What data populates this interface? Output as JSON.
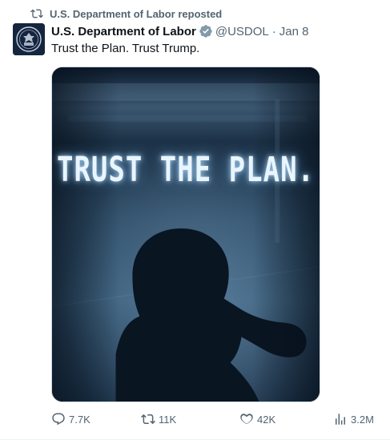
{
  "repost": {
    "icon": "repost-icon",
    "label": "U.S. Department of Labor reposted"
  },
  "post": {
    "avatar_icon": "department-of-labor-seal",
    "author": "U.S. Department of Labor",
    "badge_icon": "government-verified-badge",
    "handle": "@USDOL",
    "separator": "·",
    "date": "Jan 8",
    "text": "Trust the Plan. Trust Trump.",
    "media": {
      "caption": "TRUST THE PLAN.",
      "subject": "silhouette-saluting"
    }
  },
  "actions": {
    "reply": {
      "icon": "reply-icon",
      "count": "7.7K"
    },
    "repost": {
      "icon": "repost-icon",
      "count": "11K"
    },
    "like": {
      "icon": "heart-icon",
      "count": "42K"
    },
    "views": {
      "icon": "views-chart-icon",
      "count": "3.2M"
    }
  },
  "colors": {
    "text_primary": "#0f1419",
    "text_secondary": "#536471",
    "badge_gov": "#829aab",
    "media_dark": "#0f1f32"
  }
}
